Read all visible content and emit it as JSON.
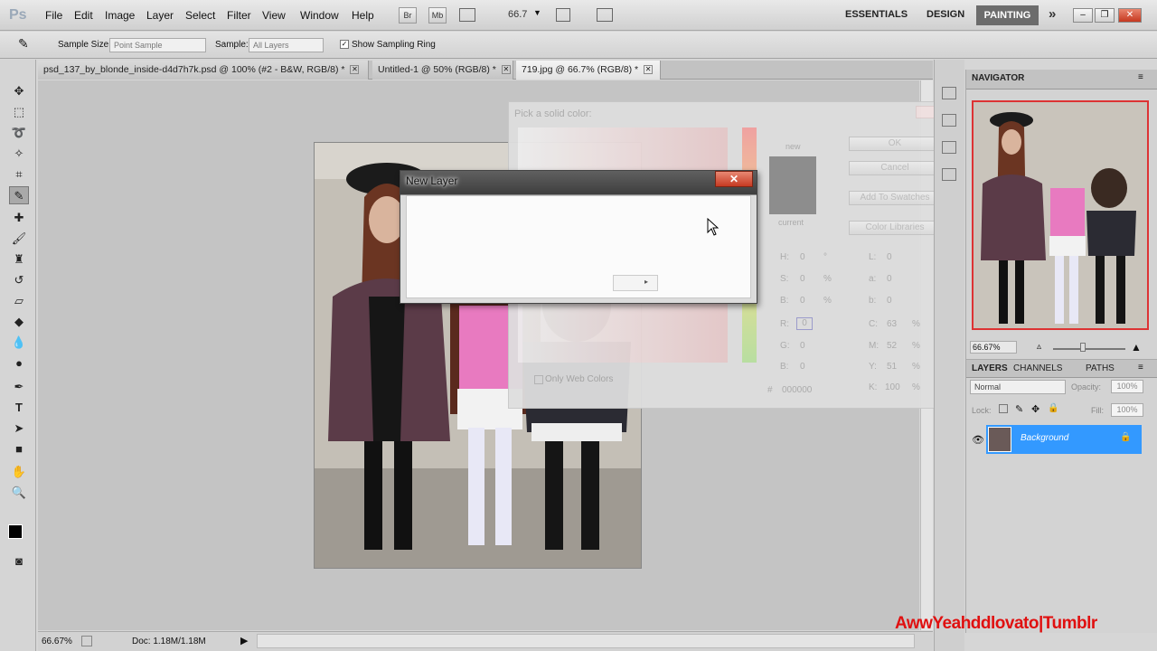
{
  "app": {
    "logo": "Ps"
  },
  "menu": [
    "File",
    "Edit",
    "Image",
    "Layer",
    "Select",
    "Filter",
    "View",
    "Window",
    "Help"
  ],
  "menubar_buttons": {
    "br": "Br",
    "mb": "Mb",
    "zoom": "66.7"
  },
  "workspaces": {
    "essentials": "ESSENTIALS",
    "design": "DESIGN",
    "painting": "PAINTING",
    "more": "»"
  },
  "options": {
    "sample_size_label": "Sample Size:",
    "sample_size_value": "Point Sample",
    "sample_label": "Sample:",
    "sample_value": "All Layers",
    "sampling_ring_label": "Show Sampling Ring"
  },
  "tabs": [
    {
      "label": "psd_137_by_blonde_inside-d4d7h7k.psd @ 100% (#2 - B&W, RGB/8) *"
    },
    {
      "label": "Untitled-1 @ 50% (RGB/8) *"
    },
    {
      "label": "719.jpg @ 66.7% (RGB/8) *"
    }
  ],
  "status": {
    "zoom": "66.67%",
    "doc": "Doc: 1.18M/1.18M"
  },
  "color_picker": {
    "title": "Pick a solid color:",
    "ok": "OK",
    "cancel": "Cancel",
    "add_swatches": "Add To Swatches",
    "libraries": "Color Libraries",
    "new": "new",
    "current": "current",
    "only_web": "Only Web Colors",
    "hsb": {
      "h": "H:",
      "h_val": "0",
      "h_unit": "°",
      "s": "S:",
      "s_val": "0",
      "s_unit": "%",
      "b": "B:",
      "b_val": "0",
      "b_unit": "%"
    },
    "rgb": {
      "r": "R:",
      "r_val": "0",
      "g": "G:",
      "g_val": "0",
      "b": "B:",
      "b_val": "0"
    },
    "lab": {
      "l": "L:",
      "l_val": "0",
      "a": "a:",
      "a_val": "0",
      "b": "b:",
      "b_val": "0"
    },
    "cmyk": {
      "c": "C:",
      "c_val": "63",
      "c_unit": "%",
      "m": "M:",
      "m_val": "52",
      "m_unit": "%",
      "y": "Y:",
      "y_val": "51",
      "y_unit": "%",
      "k": "K:",
      "k_val": "100",
      "k_unit": "%"
    },
    "hex_label": "#",
    "hex": "000000"
  },
  "new_layer": {
    "title": "New Layer",
    "close": "✕"
  },
  "navigator": {
    "title": "NAVIGATOR",
    "zoom": "66.67%"
  },
  "layers_panel": {
    "tabs": [
      "LAYERS",
      "CHANNELS",
      "PATHS"
    ],
    "blend": "Normal",
    "opacity_label": "Opacity:",
    "opacity": "100%",
    "lock_label": "Lock:",
    "fill_label": "Fill:",
    "fill": "100%",
    "layer_name": "Background"
  },
  "watermark": "AwwYeahddlovato|Tumblr"
}
